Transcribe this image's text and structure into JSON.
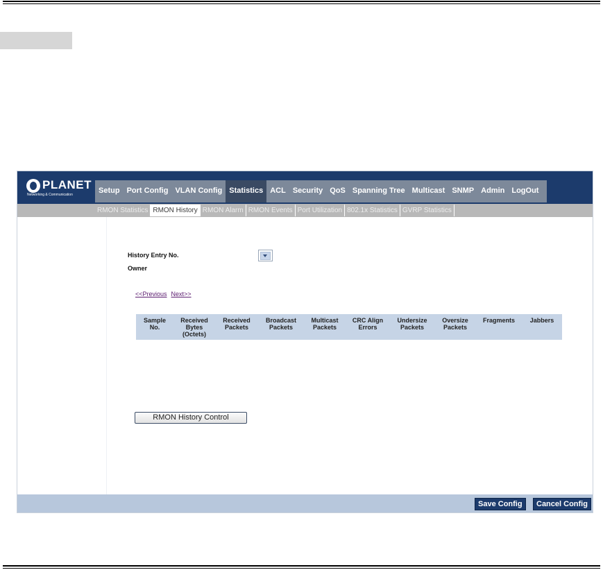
{
  "logo": {
    "text": "PLANET",
    "tagline": "Networking & Communication"
  },
  "main_nav": [
    {
      "label": "Setup",
      "active": false
    },
    {
      "label": "Port Config",
      "active": false
    },
    {
      "label": "VLAN Config",
      "active": false
    },
    {
      "label": "Statistics",
      "active": true
    },
    {
      "label": "ACL",
      "active": false
    },
    {
      "label": "Security",
      "active": false
    },
    {
      "label": "QoS",
      "active": false
    },
    {
      "label": "Spanning Tree",
      "active": false
    },
    {
      "label": "Multicast",
      "active": false
    },
    {
      "label": "SNMP",
      "active": false
    },
    {
      "label": "Admin",
      "active": false
    },
    {
      "label": "LogOut",
      "active": false
    }
  ],
  "sub_nav": [
    {
      "label": "RMON Statistics",
      "active": false
    },
    {
      "label": "RMON History",
      "active": true
    },
    {
      "label": "RMON Alarm",
      "active": false
    },
    {
      "label": "RMON Events",
      "active": false
    },
    {
      "label": "Port Utilization",
      "active": false
    },
    {
      "label": "802.1x Statistics",
      "active": false
    },
    {
      "label": "GVRP Statistics",
      "active": false
    }
  ],
  "form": {
    "history_entry_label": "History Entry No.",
    "history_entry_value": "",
    "owner_label": "Owner"
  },
  "pager": {
    "previous": "<<Previous",
    "next": "Next>>"
  },
  "table": {
    "columns": [
      [
        "Sample",
        "No."
      ],
      [
        "Received",
        "Bytes",
        "(Octets)"
      ],
      [
        "Received",
        "Packets"
      ],
      [
        "Broadcast",
        "Packets"
      ],
      [
        "Multicast",
        "Packets"
      ],
      [
        "CRC Align",
        "Errors"
      ],
      [
        "Undersize",
        "Packets"
      ],
      [
        "Oversize",
        "Packets"
      ],
      [
        "Fragments"
      ],
      [
        "Jabbers"
      ]
    ],
    "rows": []
  },
  "buttons": {
    "rmon_history_control": "RMON History Control",
    "save_config": "Save Config",
    "cancel_config": "Cancel Config"
  },
  "colors": {
    "header_bg": "#1c3b6c",
    "nav_bg": "#7d899a",
    "nav_active": "#3a4a63",
    "table_header_bg": "#c6d4e6",
    "footer_bg": "#b7c7dc"
  }
}
